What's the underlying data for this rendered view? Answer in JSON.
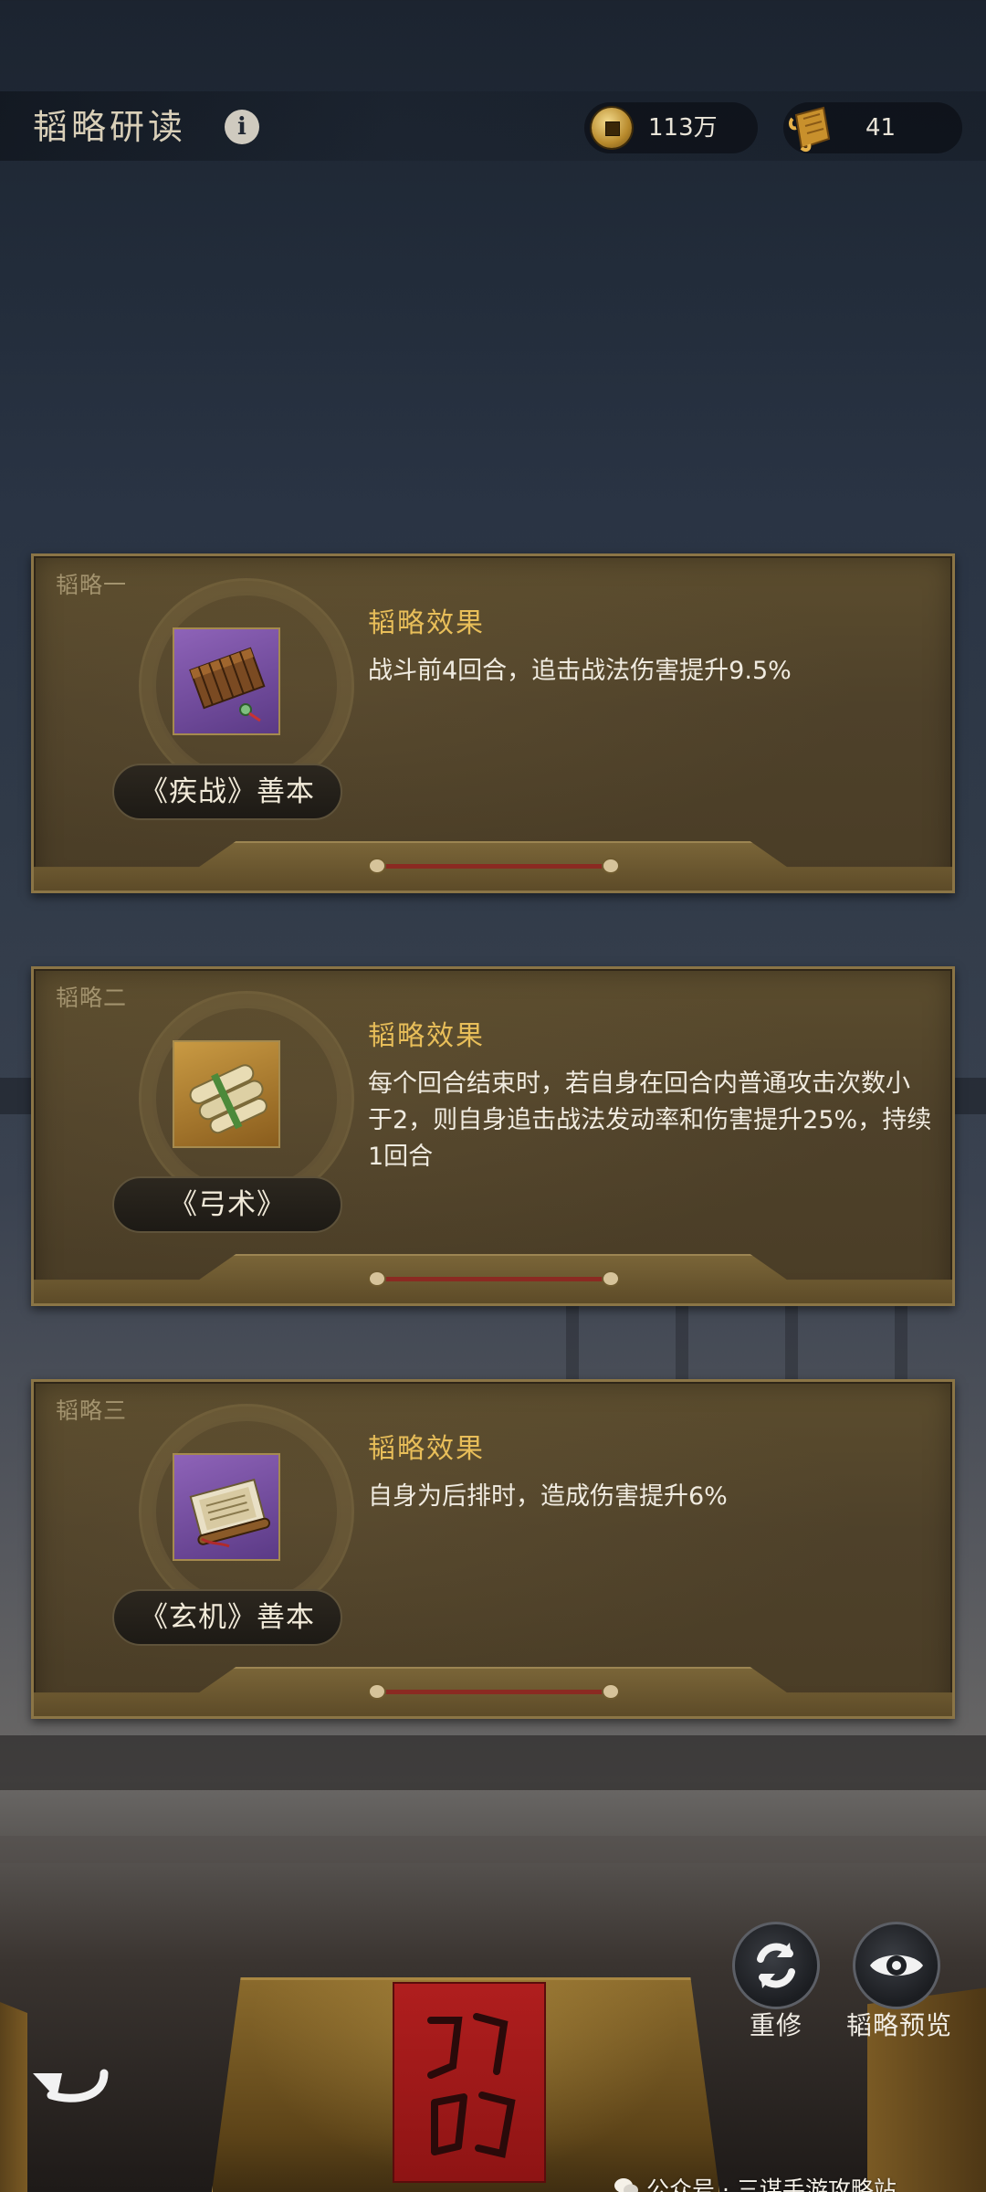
{
  "header": {
    "title": "韬略研读",
    "info_icon": "info-icon",
    "resources": [
      {
        "icon": "copper-coin-icon",
        "value": "113万"
      },
      {
        "icon": "scroll-icon",
        "value": "41"
      }
    ]
  },
  "strategies": [
    {
      "tag": "韬略一",
      "item_icon": "bamboo-book-icon",
      "item_quality_color": "#7b4fa8",
      "book_name": "《疾战》善本",
      "effect_title": "韬略效果",
      "effect_desc": "战斗前4回合，追击战法伤害提升9.5%"
    },
    {
      "tag": "韬略二",
      "item_icon": "scroll-bundle-icon",
      "item_quality_color": "#b08232",
      "book_name": "《弓术》",
      "effect_title": "韬略效果",
      "effect_desc": "每个回合结束时，若自身在回合内普通攻击次数小于2，则自身追击战法发动率和伤害提升25%，持续1回合"
    },
    {
      "tag": "韬略三",
      "item_icon": "open-book-icon",
      "item_quality_color": "#7b4fa8",
      "book_name": "《玄机》善本",
      "effect_title": "韬略效果",
      "effect_desc": "自身为后排时，造成伤害提升6%"
    }
  ],
  "actions": {
    "retrain_label": "重修",
    "preview_label": "韬略预览",
    "retrain_icon": "refresh-icon",
    "preview_icon": "eye-icon",
    "back_icon": "back-arrow-icon"
  },
  "seal_text": "韬略",
  "watermark": {
    "icon": "wechat-icon",
    "text": "公众号 · 三谋手游攻略站"
  }
}
